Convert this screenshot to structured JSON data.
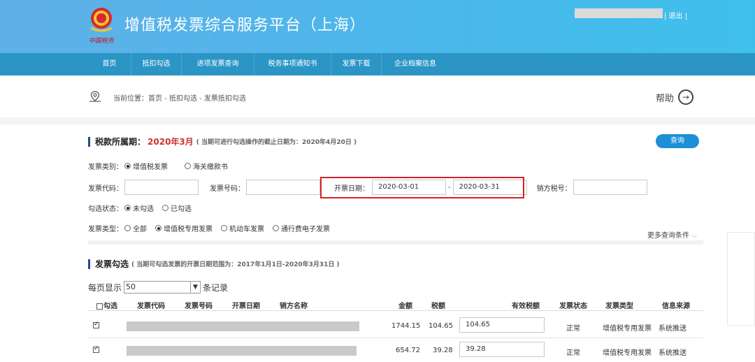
{
  "header": {
    "logo_text": "中国税务",
    "title": "增值税发票综合服务平台（上海）",
    "logout": "| 退出 |"
  },
  "nav": {
    "items": [
      "首页",
      "抵扣勾选",
      "进项发票查询",
      "税务事项通知书",
      "发票下载",
      "企业档案信息"
    ]
  },
  "breadcrumb": {
    "text": "当前位置：首页 - 抵扣勾选 - 发票抵扣勾选",
    "help": "帮助",
    "help_arrow": "→"
  },
  "tax_period": {
    "label": "税款所属期：",
    "period": "2020年3月",
    "note": "( 当期可进行勾选操作的截止日期为：2020年4月20日 )",
    "query_button": "查询"
  },
  "filters": {
    "invoice_category_label": "发票类别：",
    "invoice_category_options": [
      {
        "label": "增值税发票",
        "selected": true
      },
      {
        "label": "海关缴款书",
        "selected": false
      }
    ],
    "invoice_code_label": "发票代码：",
    "invoice_code_value": "",
    "invoice_number_label": "发票号码：",
    "invoice_number_value": "",
    "date_label": "开票日期：",
    "date_from": "2020-03-01",
    "date_sep": "-",
    "date_to": "2020-03-31",
    "seller_tax_label": "销方税号：",
    "seller_tax_value": "",
    "check_status_label": "勾选状态：",
    "check_status_options": [
      {
        "label": "未勾选",
        "selected": true
      },
      {
        "label": "已勾选",
        "selected": false
      }
    ],
    "invoice_type_label": "发票类型：",
    "invoice_type_options": [
      {
        "label": "全部",
        "selected": false
      },
      {
        "label": "增值税专用发票",
        "selected": true
      },
      {
        "label": "机动车发票",
        "selected": false
      },
      {
        "label": "通行费电子发票",
        "selected": false
      }
    ],
    "more_conditions": "更多查询条件",
    "more_icon": "chevron-down-icon"
  },
  "selection": {
    "title": "发票勾选",
    "note": "( 当期可勾选发票的开票日期范围为：2017年1月1日-2020年3月31日 )",
    "per_page_label": "每页显示",
    "per_page_value": "50",
    "per_page_suffix": "条记录"
  },
  "table": {
    "headers": [
      "勾选",
      "发票代码",
      "发票号码",
      "开票日期",
      "销方名称",
      "金额",
      "税额",
      "有效税额",
      "发票状态",
      "发票类型",
      "信息来源"
    ],
    "rows": [
      {
        "checked": true,
        "amount": "1744.15",
        "tax": "104.65",
        "valid_tax": "104.65",
        "status": "正常",
        "type": "增值税专用发票",
        "source": "系统推送"
      },
      {
        "checked": true,
        "amount": "654.72",
        "tax": "39.28",
        "valid_tax": "39.28",
        "status": "正常",
        "type": "增值税专用发票",
        "source": "系统推送"
      }
    ]
  },
  "colors": {
    "header_gradient_start": "#5fb0e8",
    "nav_bg": "#2b95c6",
    "period_red": "#d0312d",
    "highlight_box": "#d32229",
    "query_blue": "#1b8fd8"
  }
}
